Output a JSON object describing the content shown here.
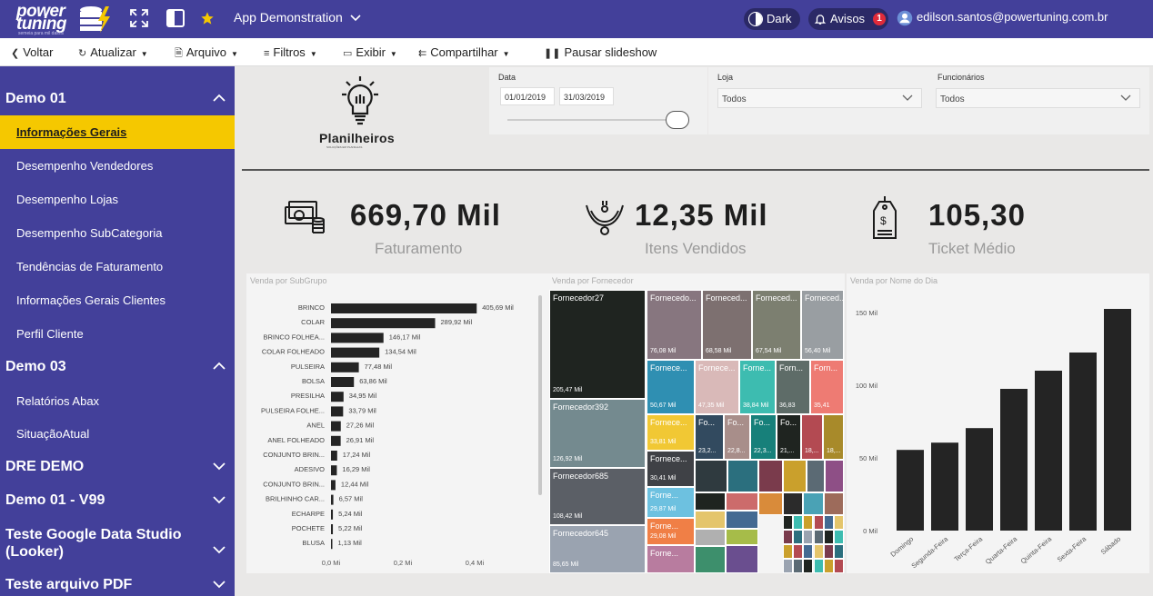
{
  "topbar": {
    "logo_line1": "power",
    "logo_line2": "tuning",
    "logo_sub": "semeia para mil dashs",
    "app_title": "App Demonstration",
    "dark_label": "Dark",
    "avisos_label": "Avisos",
    "avisos_count": "1",
    "user_email": "edilson.santos@powertuning.com.br"
  },
  "toolbar": {
    "voltar": "Voltar",
    "atualizar": "Atualizar",
    "arquivo": "Arquivo",
    "filtros": "Filtros",
    "exibir": "Exibir",
    "compartilhar": "Compartilhar",
    "pausar": "Pausar slideshow"
  },
  "sidebar": {
    "sections": [
      {
        "title": "Demo 01",
        "items": [
          "Informações Gerais",
          "Desempenho Vendedores",
          "Desempenho Lojas",
          "Desempenho SubCategoria",
          "Tendências de Faturamento",
          "Informações Gerais Clientes",
          "Perfil Cliente"
        ]
      },
      {
        "title": "Demo 03",
        "items": [
          "Relatórios Abax",
          "SituaçãoAtual"
        ]
      },
      {
        "title": "DRE DEMO",
        "items": []
      },
      {
        "title": "Demo 01 - V99",
        "items": []
      },
      {
        "title": "Teste Google Data Studio (Looker)",
        "items": []
      },
      {
        "title": "Teste arquivo PDF",
        "items": []
      }
    ],
    "active_item": "Informações Gerais"
  },
  "report": {
    "brand_name": "Planilheiros",
    "brand_tag": "SOLUÇÕES EM PLANILHAS",
    "filters": {
      "data_label": "Data",
      "date_start": "01/01/2019",
      "date_end": "31/03/2019",
      "loja_label": "Loja",
      "loja_value": "Todos",
      "func_label": "Funcionários",
      "func_value": "Todos"
    },
    "kpis": [
      {
        "value": "669,70 Mil",
        "label": "Faturamento",
        "icon": "money-icon"
      },
      {
        "value": "12,35 Mil",
        "label": "Itens Vendidos",
        "icon": "necklace-icon"
      },
      {
        "value": "105,30",
        "label": "Ticket Médio",
        "icon": "price-tag-icon"
      }
    ]
  },
  "chart_data": [
    {
      "type": "bar",
      "orientation": "horizontal",
      "title": "Venda por SubGrupo",
      "categories": [
        "BRINCO",
        "COLAR",
        "BRINCO FOLHEA...",
        "COLAR FOLHEADO",
        "PULSEIRA",
        "BOLSA",
        "PRESILHA",
        "PULSEIRA FOLHE...",
        "ANEL",
        "ANEL FOLHEADO",
        "CONJUNTO BRIN...",
        "ADESIVO",
        "CONJUNTO BRIN...",
        "BRILHINHO CAR...",
        "ECHARPE",
        "POCHETE",
        "BLUSA"
      ],
      "values": [
        405.69,
        289.92,
        146.17,
        134.54,
        77.48,
        63.86,
        34.95,
        33.79,
        27.26,
        26.91,
        17.24,
        16.29,
        12.44,
        6.57,
        5.24,
        5.22,
        1.13
      ],
      "data_labels": [
        "405,69 Mil",
        "289,92 Mil",
        "146,17 Mil",
        "134,54 Mil",
        "77,48 Mil",
        "63,86 Mil",
        "34,95 Mil",
        "33,79 Mil",
        "27,26 Mil",
        "26,91 Mil",
        "17,24 Mil",
        "16,29 Mil",
        "12,44 Mil",
        "6,57 Mil",
        "5,24 Mil",
        "5,22 Mil",
        "1,13 Mil"
      ],
      "x_ticks": [
        "0,0 Mi",
        "0,2 Mi",
        "0,4 Mi"
      ],
      "xlim": [
        0,
        0.4
      ],
      "unit": "Mil"
    },
    {
      "type": "treemap",
      "title": "Venda por Fornecedor",
      "items": [
        {
          "name": "Fornecedor27",
          "value": "205,47 Mil",
          "color": "#1f2420"
        },
        {
          "name": "Fornecedor392",
          "value": "126,92 Mil",
          "color": "#748a8f"
        },
        {
          "name": "Fornecedor685",
          "value": "108,42 Mil",
          "color": "#5b5f66"
        },
        {
          "name": "Fornecedor645",
          "value": "85,65 Mil",
          "color": "#9aa3b0"
        },
        {
          "name": "Fornecedo...",
          "value": "76,08 Mil",
          "color": "#87767f"
        },
        {
          "name": "Forneced...",
          "value": "68,58 Mil",
          "color": "#7d7070"
        },
        {
          "name": "Forneced...",
          "value": "67,54 Mil",
          "color": "#7c7f70"
        },
        {
          "name": "Forneced...",
          "value": "56,40 Mil",
          "color": "#999ea2"
        },
        {
          "name": "Fornece...",
          "value": "50,67 Mil",
          "color": "#2f8fb2"
        },
        {
          "name": "Fornece...",
          "value": "47,35 Mil",
          "color": "#d9b9b8"
        },
        {
          "name": "Forne...",
          "value": "38,84 Mil",
          "color": "#3dbcb0"
        },
        {
          "name": "Forn...",
          "value": "36,83",
          "color": "#5e6c68"
        },
        {
          "name": "Forn...",
          "value": "35,41",
          "color": "#ee7b73"
        },
        {
          "name": "Fornece...",
          "value": "33,81 Mil",
          "color": "#f1c834"
        },
        {
          "name": "Fornece...",
          "value": "30,41 Mil",
          "color": "#3f4146"
        },
        {
          "name": "Forne...",
          "value": "29,87 Mil",
          "color": "#6dc1e0"
        },
        {
          "name": "Forne...",
          "value": "29,08 Mil",
          "color": "#f07f46"
        },
        {
          "name": "Forne...",
          "value": "",
          "color": "#b87c9f"
        },
        {
          "name": "Fo...",
          "value": "23,2...",
          "color": "#324a5f"
        },
        {
          "name": "Fo...",
          "value": "22,8...",
          "color": "#a88e8a"
        },
        {
          "name": "Fo...",
          "value": "22,3...",
          "color": "#17807a"
        },
        {
          "name": "Fo...",
          "value": "21,...",
          "color": "#1f2420"
        },
        {
          "name": "",
          "value": "18,...",
          "color": "#b34a52"
        },
        {
          "name": "",
          "value": "18,...",
          "color": "#a88a2a"
        }
      ]
    },
    {
      "type": "bar",
      "title": "Venda por Nome do Dia",
      "categories": [
        "Domingo",
        "Segunda-Feira",
        "Terça-Feira",
        "Quarta-Feira",
        "Quinta-Feira",
        "Sexta-Feira",
        "Sábado"
      ],
      "values": [
        55.5,
        60.5,
        70.5,
        97.5,
        110,
        122.5,
        152.5
      ],
      "y_ticks": [
        "0 Mil",
        "50 Mil",
        "100 Mil",
        "150 Mil"
      ],
      "ylim": [
        0,
        150
      ],
      "unit": "Mil"
    }
  ]
}
